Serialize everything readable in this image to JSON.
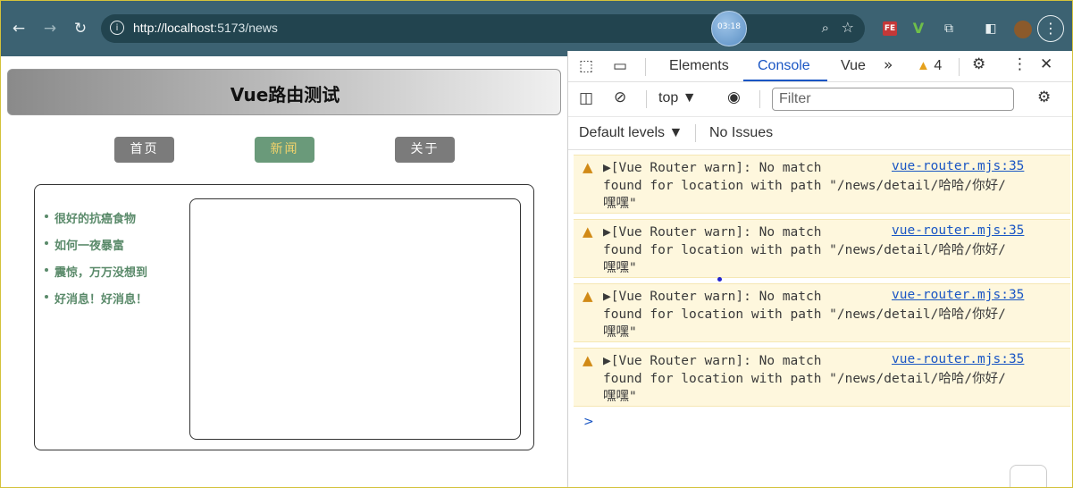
{
  "browser": {
    "url_host": "http://localhost",
    "url_rest": ":5173/news",
    "clock_badge": "03:18"
  },
  "page": {
    "title": "Vue路由测试",
    "nav": [
      {
        "label": "首页",
        "active": false
      },
      {
        "label": "新闻",
        "active": true
      },
      {
        "label": "关于",
        "active": false
      }
    ],
    "news_items": [
      "很好的抗癌食物",
      "如何一夜暴富",
      "震惊，万万没想到",
      "好消息！好消息！"
    ]
  },
  "devtools": {
    "tabs": [
      "Elements",
      "Console",
      "Vue"
    ],
    "active_tab": "Console",
    "warning_count": "4",
    "context": "top",
    "filter_placeholder": "Filter",
    "levels_label": "Default levels",
    "issues_label": "No Issues",
    "messages": [
      {
        "text": "▶[Vue Router warn]: No match\nfound for location with path \"/news/detail/哈哈/你好/\n嘿嘿\"",
        "source": "vue-router.mjs:35"
      },
      {
        "text": "▶[Vue Router warn]: No match\nfound for location with path \"/news/detail/哈哈/你好/\n嘿嘿\"",
        "source": "vue-router.mjs:35"
      },
      {
        "text": "▶[Vue Router warn]: No match\nfound for location with path \"/news/detail/哈哈/你好/\n嘿嘿\"",
        "source": "vue-router.mjs:35"
      },
      {
        "text": "▶[Vue Router warn]: No match\nfound for location with path \"/news/detail/哈哈/你好/\n嘿嘿\"",
        "source": "vue-router.mjs:35"
      }
    ],
    "prompt_symbol": ">"
  }
}
